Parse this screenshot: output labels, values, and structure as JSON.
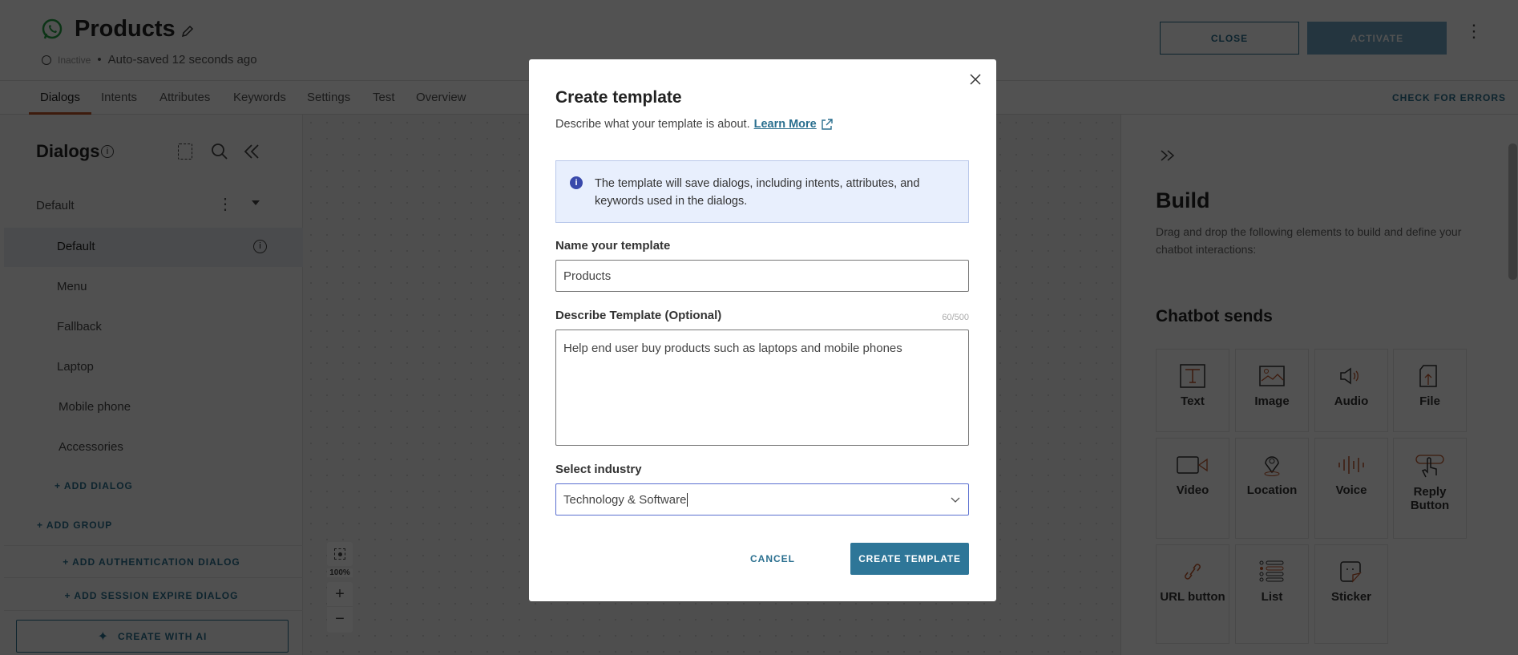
{
  "header": {
    "title": "Products",
    "status": "Inactive",
    "autosave": "Auto-saved 12 seconds ago",
    "close_label": "CLOSE",
    "activate_label": "ACTIVATE"
  },
  "tabs": [
    {
      "label": "Dialogs",
      "active": true
    },
    {
      "label": "Intents"
    },
    {
      "label": "Attributes"
    },
    {
      "label": "Keywords"
    },
    {
      "label": "Settings"
    },
    {
      "label": "Test"
    },
    {
      "label": "Overview"
    }
  ],
  "check_errors": "CHECK FOR ERRORS",
  "sidebar": {
    "heading": "Dialogs",
    "group": "Default",
    "items": [
      "Default",
      "Menu",
      "Fallback",
      "Laptop",
      "Mobile phone",
      "Accessories"
    ],
    "add_dialog": "+ ADD DIALOG",
    "add_group": "+ ADD GROUP",
    "add_auth": "+ ADD AUTHENTICATION DIALOG",
    "add_session": "+ ADD SESSION EXPIRE DIALOG",
    "create_ai": "CREATE WITH AI"
  },
  "canvas": {
    "zoom": "100%"
  },
  "build": {
    "title": "Build",
    "description": "Drag and drop the following elements to build and define your chatbot interactions:",
    "section": "Chatbot sends",
    "elements": [
      "Text",
      "Image",
      "Audio",
      "File",
      "Video",
      "Location",
      "Voice",
      "Reply Button",
      "URL button",
      "List",
      "Sticker"
    ]
  },
  "modal": {
    "title": "Create template",
    "subtitle": "Describe what your template is about.",
    "learn_more": "Learn More",
    "info": "The template will save dialogs, including intents, attributes, and keywords used in the dialogs.",
    "name_label": "Name your template",
    "name_value": "Products",
    "desc_label": "Describe Template (Optional)",
    "desc_count": "60/500",
    "desc_value": "Help end user buy products such as laptops and mobile phones",
    "industry_label": "Select industry",
    "industry_value": "Technology & Software",
    "cancel": "CANCEL",
    "create": "CREATE TEMPLATE"
  },
  "colors": {
    "accent": "#2e7698",
    "whatsapp": "#25a244",
    "info_bg": "#e8effd",
    "icon_orange": "#c0552a"
  }
}
